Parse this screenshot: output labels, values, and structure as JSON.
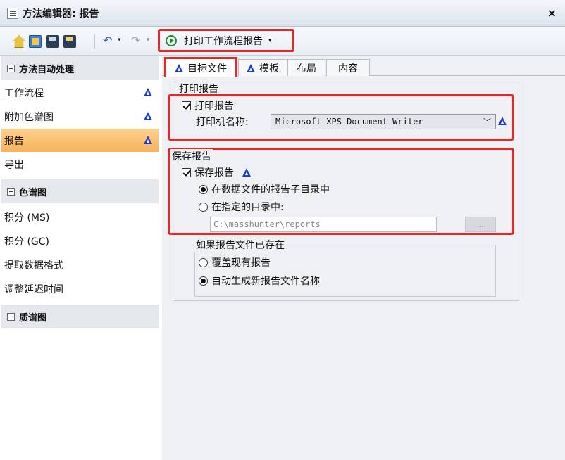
{
  "window": {
    "title": "方法编辑器: 报告",
    "close_label": "×"
  },
  "toolbar": {
    "home_icon": "home-icon",
    "undo_glyph": "↶",
    "redo_glyph": "↷",
    "dropdown_glyph": "▾",
    "run_report_label": "打印工作流程报告"
  },
  "sidebar": {
    "sections": [
      {
        "label": "方法自动处理",
        "expanded": true
      },
      {
        "label": "色谱图",
        "expanded": true
      },
      {
        "label": "质谱图",
        "expanded": false
      }
    ],
    "items": [
      {
        "label": "工作流程",
        "warning": true
      },
      {
        "label": "附加色谱图",
        "warning": true
      },
      {
        "label": "报告",
        "warning": true,
        "active": true
      },
      {
        "label": "导出",
        "warning": false
      },
      {
        "label": "积分 (MS)"
      },
      {
        "label": "积分 (GC)"
      },
      {
        "label": "提取数据格式"
      },
      {
        "label": "调整延迟时间"
      }
    ]
  },
  "tabs": [
    {
      "label": "目标文件",
      "warning": true,
      "active": true
    },
    {
      "label": "模板",
      "warning": true
    },
    {
      "label": "布局"
    },
    {
      "label": "内容"
    }
  ],
  "print_report": {
    "group_title": "打印报告",
    "checkbox_label": "打印报告",
    "checked": true,
    "printer_label": "打印机名称:",
    "printer_value": "Microsoft XPS Document Writer"
  },
  "save_report": {
    "group_title": "保存报告",
    "checkbox_label": "保存报告",
    "checked": true,
    "option_subdir": "在数据文件的报告子目录中",
    "option_custom": "在指定的目录中:",
    "path_value": "C:\\masshunter\\reports",
    "browse_label": "..."
  },
  "if_exists": {
    "group_title": "如果报告文件已存在",
    "option_overwrite": "覆盖现有报告",
    "option_autoname": "自动生成新报告文件名称"
  },
  "colors": {
    "accent": "#e62727",
    "warning": "#1a3fd0",
    "active_nav": "#f7b25c"
  }
}
